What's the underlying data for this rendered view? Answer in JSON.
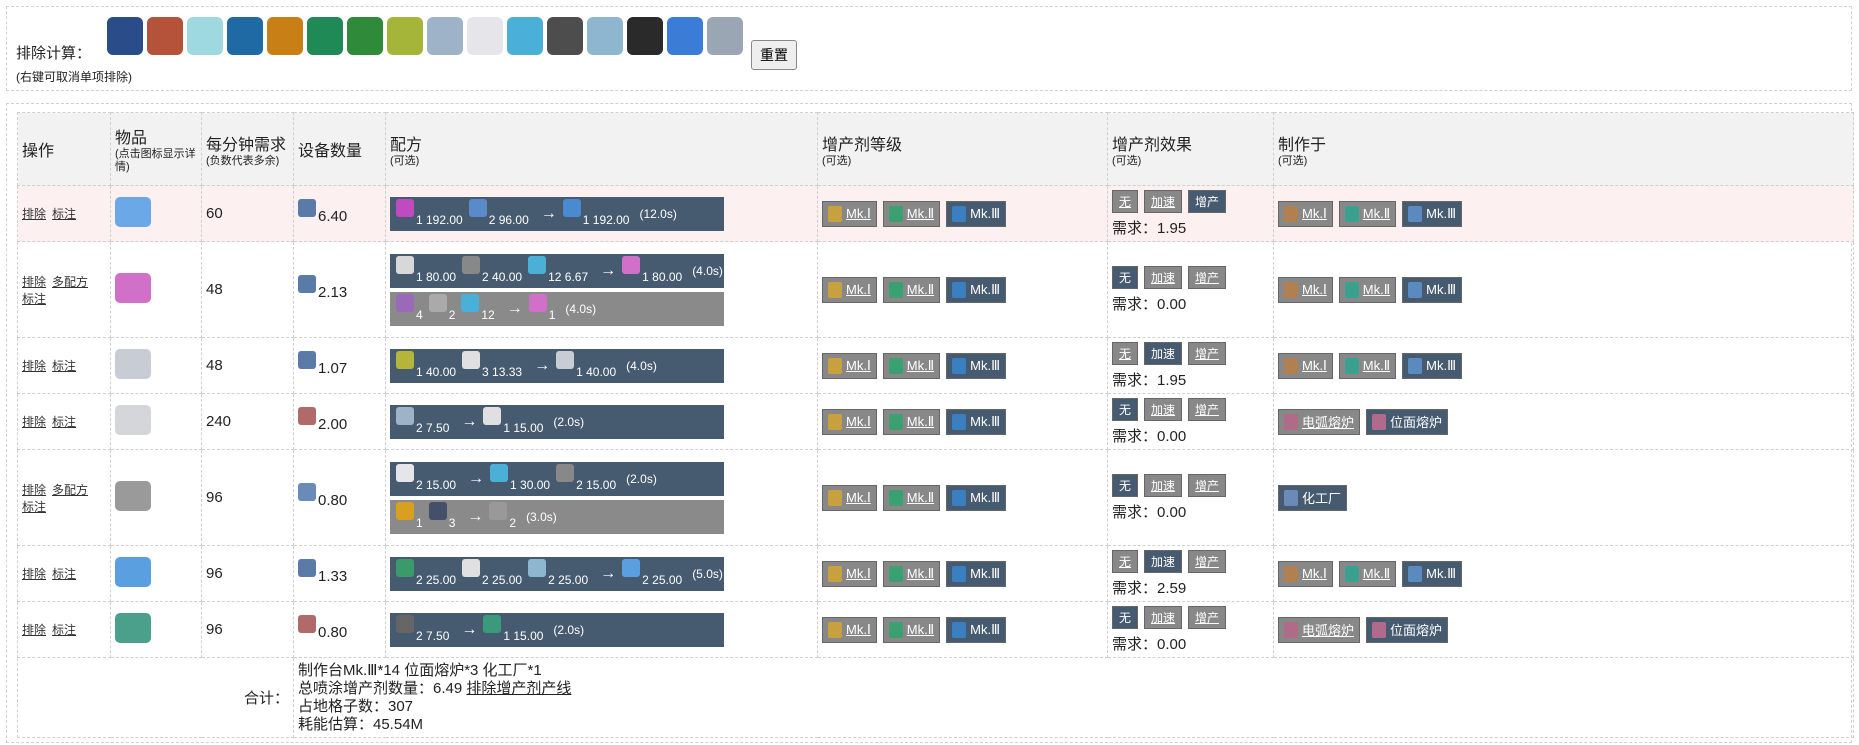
{
  "exclude": {
    "label": "排除计算：",
    "hint": "(右键可取消单项排除)",
    "icons": [
      {
        "name": "ore-cluster-icon",
        "color": "#2a4d8a"
      },
      {
        "name": "red-crystal-icon",
        "color": "#b5523a"
      },
      {
        "name": "spiky-crystal-icon",
        "color": "#9ed9e0"
      },
      {
        "name": "blue-container-icon",
        "color": "#1f6aa5"
      },
      {
        "name": "orange-container-icon",
        "color": "#c77f16"
      },
      {
        "name": "green-container-icon",
        "color": "#1f8a55"
      },
      {
        "name": "green-ore-icon",
        "color": "#2f8a3a"
      },
      {
        "name": "leaf-icon",
        "color": "#a5b53a"
      },
      {
        "name": "silicon-ore-icon",
        "color": "#9fb3c8"
      },
      {
        "name": "white-cube-icon",
        "color": "#e6e6ea"
      },
      {
        "name": "orb-icon",
        "color": "#4ab0d8"
      },
      {
        "name": "stone-icon",
        "color": "#4d4d4d"
      },
      {
        "name": "water-drop-icon",
        "color": "#8fb6cf"
      },
      {
        "name": "coal-icon",
        "color": "#2a2a2a"
      },
      {
        "name": "blue-plate-icon",
        "color": "#3a7cd6"
      },
      {
        "name": "circuit-board-icon",
        "color": "#9aa6b3"
      }
    ],
    "reset": "重置"
  },
  "table": {
    "headers": {
      "op": "操作",
      "item": "物品",
      "item_sub": "(点击图标显示详情)",
      "rate": "每分钟需求",
      "rate_sub": "(负数代表多余)",
      "count": "设备数量",
      "recipe": "配方",
      "recipe_sub": "(可选)",
      "level": "增产剂等级",
      "level_sub": "(可选)",
      "effect": "增产剂效果",
      "effect_sub": "(可选)",
      "made": "制作于",
      "made_sub": "(可选)"
    },
    "labels": {
      "exclude": "排除",
      "multi": "多配方",
      "mark": "标注",
      "mk1": "Mk.Ⅰ",
      "mk2": "Mk.Ⅱ",
      "mk3": "Mk.Ⅲ",
      "none": "无",
      "speed": "加速",
      "prod": "增产",
      "demand_prefix": "需求：",
      "arc": "电弧熔炉",
      "plane": "位面熔炉",
      "chem": "化工厂"
    },
    "rows": [
      {
        "item_icon": "#6aa8e8",
        "rate": "60",
        "device_icon": "#5a7aa8",
        "count": "6.40",
        "demand": "1.95",
        "multi": false,
        "hl": true,
        "recipes": [
          {
            "gray": false,
            "inputs": [
              {
                "c": "#c04bc0",
                "q": "1",
                "r": "192.00"
              },
              {
                "c": "#5a8ac8",
                "q": "2",
                "r": "96.00"
              }
            ],
            "outputs": [
              {
                "c": "#4a8ad0",
                "q": "1",
                "r": "192.00"
              }
            ],
            "time": "(12.0s)"
          }
        ],
        "effect": "prod",
        "made": "assembler"
      },
      {
        "item_icon": "#d070c8",
        "rate": "48",
        "device_icon": "#5a7aa8",
        "count": "2.13",
        "demand": "0.00",
        "multi": true,
        "hl": false,
        "recipes": [
          {
            "gray": false,
            "inputs": [
              {
                "c": "#d8d8d8",
                "q": "1",
                "r": "80.00"
              },
              {
                "c": "#888888",
                "q": "2",
                "r": "40.00"
              },
              {
                "c": "#4ab0d8",
                "q": "12",
                "r": "6.67"
              }
            ],
            "outputs": [
              {
                "c": "#d070c8",
                "q": "1",
                "r": "80.00"
              }
            ],
            "time": "(4.0s)"
          },
          {
            "gray": true,
            "inputs": [
              {
                "c": "#9a6ab8",
                "q": "4",
                "r": ""
              },
              {
                "c": "#aaaaaa",
                "q": "2",
                "r": ""
              },
              {
                "c": "#4ab0d8",
                "q": "12",
                "r": ""
              }
            ],
            "outputs": [
              {
                "c": "#d070c8",
                "q": "1",
                "r": ""
              }
            ],
            "time": "(4.0s)"
          }
        ],
        "effect": "none",
        "made": "assembler"
      },
      {
        "item_icon": "#c8ccd4",
        "rate": "48",
        "device_icon": "#5a7aa8",
        "count": "1.07",
        "demand": "1.95",
        "multi": false,
        "hl": false,
        "recipes": [
          {
            "gray": false,
            "inputs": [
              {
                "c": "#b5b53a",
                "q": "1",
                "r": "40.00"
              },
              {
                "c": "#e0e0e0",
                "q": "3",
                "r": "13.33"
              }
            ],
            "outputs": [
              {
                "c": "#c8ccd4",
                "q": "1",
                "r": "40.00"
              }
            ],
            "time": "(4.0s)"
          }
        ],
        "effect": "speed",
        "made": "assembler"
      },
      {
        "item_icon": "#d4d6da",
        "rate": "240",
        "device_icon": "#b06a6a",
        "count": "2.00",
        "demand": "0.00",
        "multi": false,
        "hl": false,
        "recipes": [
          {
            "gray": false,
            "inputs": [
              {
                "c": "#9fb3c8",
                "q": "2",
                "r": "7.50"
              }
            ],
            "outputs": [
              {
                "c": "#e0e0e0",
                "q": "1",
                "r": "15.00"
              }
            ],
            "time": "(2.0s)"
          }
        ],
        "effect": "none",
        "made": "smelter"
      },
      {
        "item_icon": "#9a9a9a",
        "rate": "96",
        "device_icon": "#6a8ab8",
        "count": "0.80",
        "demand": "0.00",
        "multi": true,
        "hl": false,
        "recipes": [
          {
            "gray": false,
            "inputs": [
              {
                "c": "#e6e6ea",
                "q": "2",
                "r": "15.00"
              }
            ],
            "outputs": [
              {
                "c": "#4ab0d8",
                "q": "1",
                "r": "30.00"
              },
              {
                "c": "#888888",
                "q": "2",
                "r": "15.00"
              }
            ],
            "time": "(2.0s)"
          },
          {
            "gray": true,
            "inputs": [
              {
                "c": "#d8a020",
                "q": "1",
                "r": ""
              },
              {
                "c": "#44506a",
                "q": "3",
                "r": ""
              }
            ],
            "outputs": [
              {
                "c": "#999999",
                "q": "2",
                "r": ""
              }
            ],
            "time": "(3.0s)"
          }
        ],
        "effect": "none",
        "made": "chem"
      },
      {
        "item_icon": "#5aa0e0",
        "rate": "96",
        "device_icon": "#5a7aa8",
        "count": "1.33",
        "demand": "2.59",
        "multi": false,
        "hl": false,
        "recipes": [
          {
            "gray": false,
            "inputs": [
              {
                "c": "#3a9a6a",
                "q": "2",
                "r": "25.00"
              },
              {
                "c": "#e0e0e0",
                "q": "2",
                "r": "25.00"
              },
              {
                "c": "#8fb6cf",
                "q": "2",
                "r": "25.00"
              }
            ],
            "outputs": [
              {
                "c": "#5aa0e0",
                "q": "2",
                "r": "25.00"
              }
            ],
            "time": "(5.0s)"
          }
        ],
        "effect": "speed",
        "made": "assembler"
      },
      {
        "item_icon": "#4aa08a",
        "rate": "96",
        "device_icon": "#b06a6a",
        "count": "0.80",
        "demand": "0.00",
        "multi": false,
        "hl": false,
        "recipes": [
          {
            "gray": false,
            "inputs": [
              {
                "c": "#666666",
                "q": "2",
                "r": "7.50"
              }
            ],
            "outputs": [
              {
                "c": "#3a9a7a",
                "q": "1",
                "r": "15.00"
              }
            ],
            "time": "(2.0s)"
          }
        ],
        "effect": "none",
        "made": "smelter"
      }
    ],
    "summary": {
      "label": "合计：",
      "line1": "制作台Mk.Ⅲ*14 位面熔炉*3 化工厂*1",
      "line2_prefix": "总喷涂增产剂数量：6.49",
      "line2_link": "排除增产剂产线",
      "line3": "占地格子数：307",
      "line4": "耗能估算：45.54M"
    }
  }
}
